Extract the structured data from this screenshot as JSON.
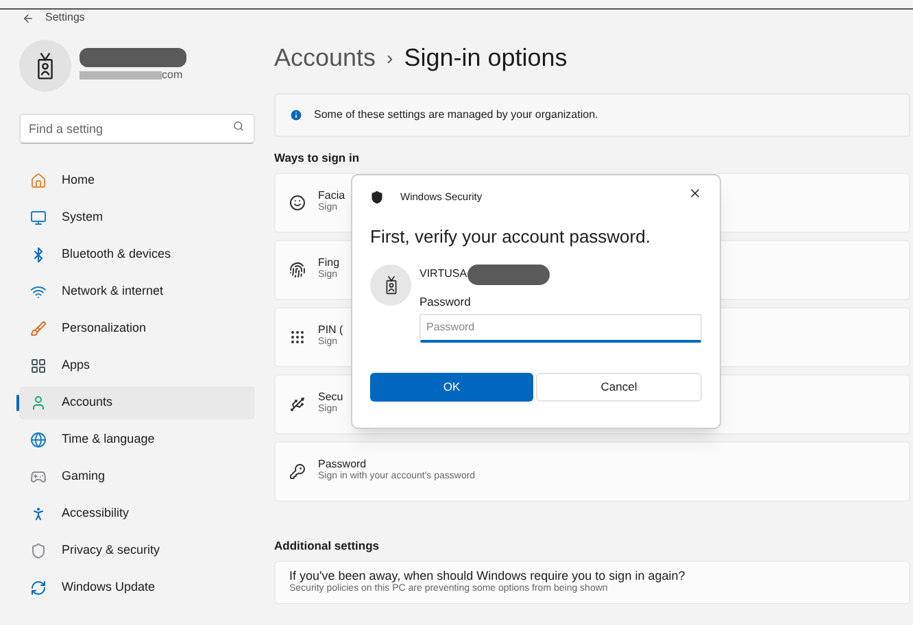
{
  "window": {
    "title": "Settings"
  },
  "profile": {
    "email_visible_part": "com"
  },
  "search": {
    "placeholder": "Find a setting"
  },
  "sidebar": {
    "items": [
      {
        "label": "Home",
        "kind": "home",
        "selected": false
      },
      {
        "label": "System",
        "kind": "system",
        "selected": false
      },
      {
        "label": "Bluetooth & devices",
        "kind": "bluetooth",
        "selected": false
      },
      {
        "label": "Network & internet",
        "kind": "network",
        "selected": false
      },
      {
        "label": "Personalization",
        "kind": "brush",
        "selected": false
      },
      {
        "label": "Apps",
        "kind": "apps",
        "selected": false
      },
      {
        "label": "Accounts",
        "kind": "accounts",
        "selected": true
      },
      {
        "label": "Time & language",
        "kind": "time",
        "selected": false
      },
      {
        "label": "Gaming",
        "kind": "gaming",
        "selected": false
      },
      {
        "label": "Accessibility",
        "kind": "accessibility",
        "selected": false
      },
      {
        "label": "Privacy & security",
        "kind": "privacy",
        "selected": false
      },
      {
        "label": "Windows Update",
        "kind": "update",
        "selected": false
      }
    ]
  },
  "breadcrumb": {
    "parent": "Accounts",
    "separator": "›",
    "current": "Sign-in options"
  },
  "info_bar": {
    "text": "Some of these settings are managed by your organization."
  },
  "ways_section": {
    "title": "Ways to sign in",
    "items": [
      {
        "kind": "face",
        "title": "Facia",
        "subtitle": "Sign"
      },
      {
        "kind": "fingerprint",
        "title": "Fing",
        "subtitle": "Sign"
      },
      {
        "kind": "pin",
        "title": "PIN (",
        "subtitle": "Sign"
      },
      {
        "kind": "key",
        "title": "Secu",
        "subtitle": "Sign"
      },
      {
        "kind": "password",
        "title": "Password",
        "subtitle": "Sign in with your account's password"
      }
    ]
  },
  "additional_section": {
    "title": "Additional settings",
    "card": {
      "title": "If you've been away, when should Windows require you to sign in again?",
      "subtitle": "Security policies on this PC are preventing some options from being shown"
    }
  },
  "dialog": {
    "title": "Windows Security",
    "heading": "First, verify your account password.",
    "user_visible_part": "VIRTUSA",
    "field_label": "Password",
    "placeholder": "Password",
    "buttons": [
      {
        "label": "OK",
        "kind": "primary"
      },
      {
        "label": "Cancel",
        "kind": "secondary"
      }
    ]
  }
}
